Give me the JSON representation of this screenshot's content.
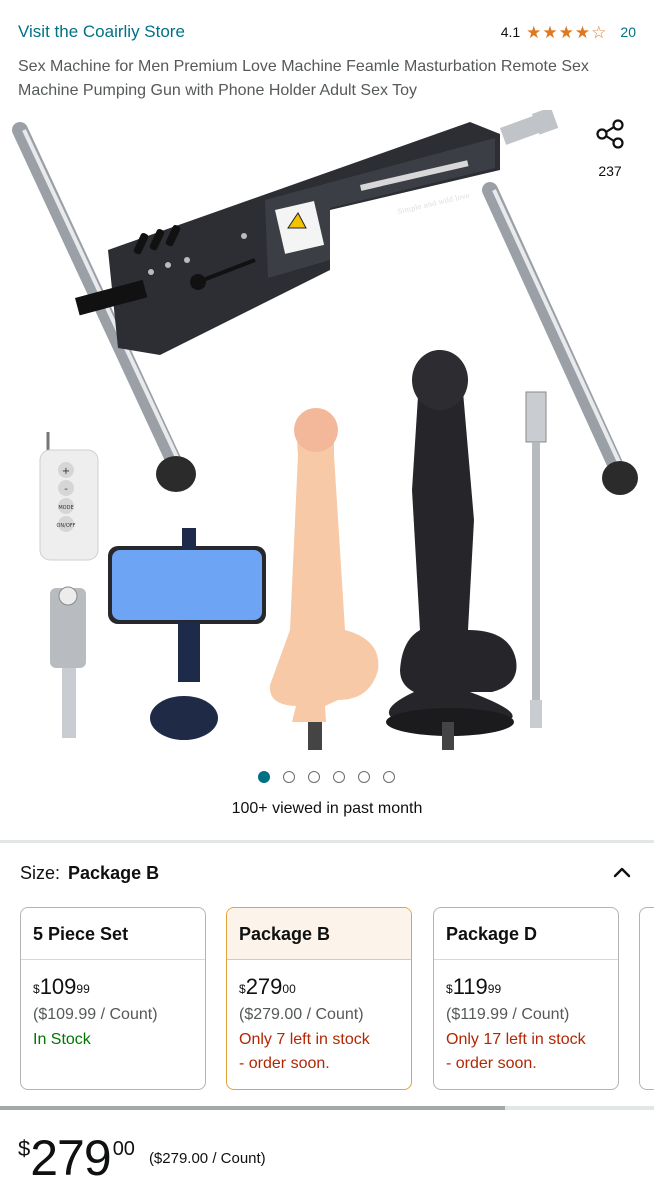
{
  "header": {
    "store_link": "Visit the Coairliy Store",
    "rating_value": "4.1",
    "rating_count": "20",
    "stars": {
      "full": 4,
      "empty": 1
    }
  },
  "product": {
    "title": "Sex Machine for Men Premium Love Machine Feamle Masturbation Remote Sex Machine Pumping Gun with Phone Holder Adult Sex Toy"
  },
  "gallery": {
    "image_icons": [
      "machine-frame",
      "remote-control",
      "connector-adapter",
      "phone-holder",
      "dildo-flesh",
      "dildo-black",
      "extension-rod"
    ],
    "engraving": "Simple and wild love",
    "remote_buttons": [
      "+",
      "-",
      "MODE",
      "ON/OFF"
    ],
    "active_dot": 0,
    "dot_count": 6
  },
  "share": {
    "count": "237",
    "icon": "share-icon"
  },
  "viewed_text": "100+ viewed in past month",
  "size": {
    "label": "Size:",
    "selected": "Package B",
    "options": [
      {
        "name": "5 Piece Set",
        "symbol": "$",
        "whole": "109",
        "fraction": "99",
        "unit": "($109.99 / Count)",
        "stock1": "In Stock",
        "stock2": "",
        "status": "ok"
      },
      {
        "name": "Package B",
        "symbol": "$",
        "whole": "279",
        "fraction": "00",
        "unit": "($279.00 / Count)",
        "stock1": "Only 7 left in stock",
        "stock2": "- order soon.",
        "status": "low"
      },
      {
        "name": "Package D",
        "symbol": "$",
        "whole": "119",
        "fraction": "99",
        "unit": "($119.99 / Count)",
        "stock1": "Only 17 left in stock",
        "stock2": "- order soon.",
        "status": "low"
      }
    ]
  },
  "buy": {
    "symbol": "$",
    "whole": "279",
    "fraction": "00",
    "unit": "($279.00 / Count)"
  },
  "colors": {
    "link": "#007185",
    "star": "#de7921",
    "in_stock": "#007600",
    "low_stock": "#b12704",
    "selected_border": "#e5a23b"
  }
}
